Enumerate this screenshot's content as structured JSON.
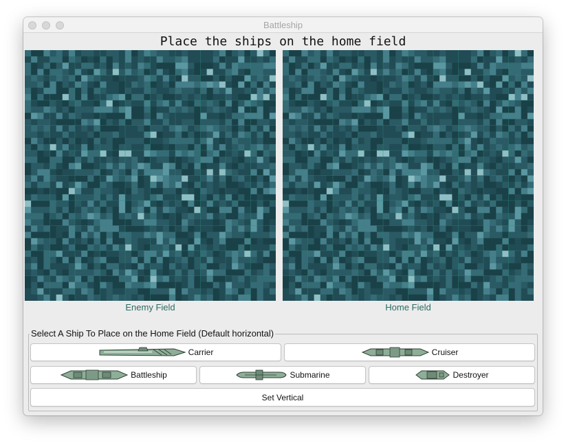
{
  "window": {
    "title": "Battleship"
  },
  "heading": "Place the ships on the home field",
  "boards": {
    "enemy_label": "Enemy Field",
    "home_label": "Home Field"
  },
  "ship_panel": {
    "legend": "Select A Ship To Place on the Home Field (Default horizontal)",
    "ships": [
      {
        "label": "Carrier",
        "icon": "carrier-icon"
      },
      {
        "label": "Cruiser",
        "icon": "cruiser-icon"
      },
      {
        "label": "Battleship",
        "icon": "battleship-icon"
      },
      {
        "label": "Submarine",
        "icon": "submarine-icon"
      },
      {
        "label": "Destroyer",
        "icon": "destroyer-icon"
      }
    ],
    "vertical_button": "Set Vertical"
  },
  "colors": {
    "water_palette": [
      "#1a4148",
      "#214c55",
      "#2a5a64",
      "#356b75",
      "#457f89",
      "#5b97a0",
      "#8fbfc4"
    ],
    "grid_line": "#2a8a7e",
    "field_label": "#2b6b62",
    "ship_hull": "#8fae98"
  }
}
